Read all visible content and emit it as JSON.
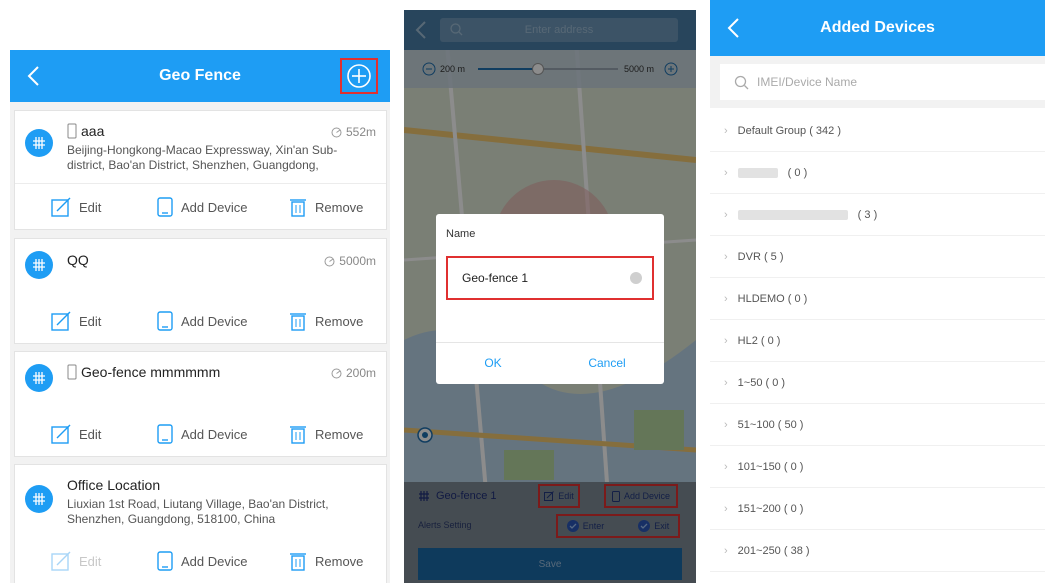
{
  "geo_fence": {
    "title": "Geo Fence",
    "cards": [
      {
        "name": "aaa",
        "distance": "552m",
        "address": "Beijing-Hongkong-Macao Expressway, Xin'an Sub-district, Bao'an District, Shenzhen, Guangdong,",
        "edit": "Edit",
        "add_device": "Add Device",
        "remove": "Remove"
      },
      {
        "name": "QQ",
        "distance": "5000m",
        "address": "",
        "edit": "Edit",
        "add_device": "Add Device",
        "remove": "Remove"
      },
      {
        "name": "Geo-fence mmmmmm",
        "distance": "200m",
        "address": "",
        "edit": "Edit",
        "add_device": "Add Device",
        "remove": "Remove"
      },
      {
        "name": "Office Location",
        "distance": "",
        "address": "Liuxian 1st Road, Liutang Village, Bao'an District, Shenzhen, Guangdong, 518100, China",
        "edit": "Edit",
        "add_device": "Add Device",
        "remove": "Remove"
      }
    ]
  },
  "map_editor": {
    "search_placeholder": "Enter address",
    "range_min": "200 m",
    "range_max": "5000 m",
    "dialog": {
      "label": "Name",
      "value": "Geo-fence 1",
      "ok": "OK",
      "cancel": "Cancel"
    },
    "fence_name": "Geo-fence 1",
    "edit": "Edit",
    "add_device": "Add Device",
    "alerts_setting": "Alerts Setting",
    "enter": "Enter",
    "exit": "Exit",
    "save": "Save"
  },
  "devices": {
    "title": "Added Devices",
    "search_placeholder": "IMEI/Device Name",
    "groups": [
      "Default Group ( 342 )",
      "( 0 )",
      "( 3 )",
      "DVR ( 5 )",
      "HLDEMO ( 0 )",
      "HL2 ( 0 )",
      "1~50 ( 0 )",
      "51~100 ( 50 )",
      "101~150 ( 0 )",
      "151~200 ( 0 )",
      "201~250 ( 38 )"
    ]
  },
  "colors": {
    "accent": "#1e9df4",
    "highlight": "#e03030"
  }
}
